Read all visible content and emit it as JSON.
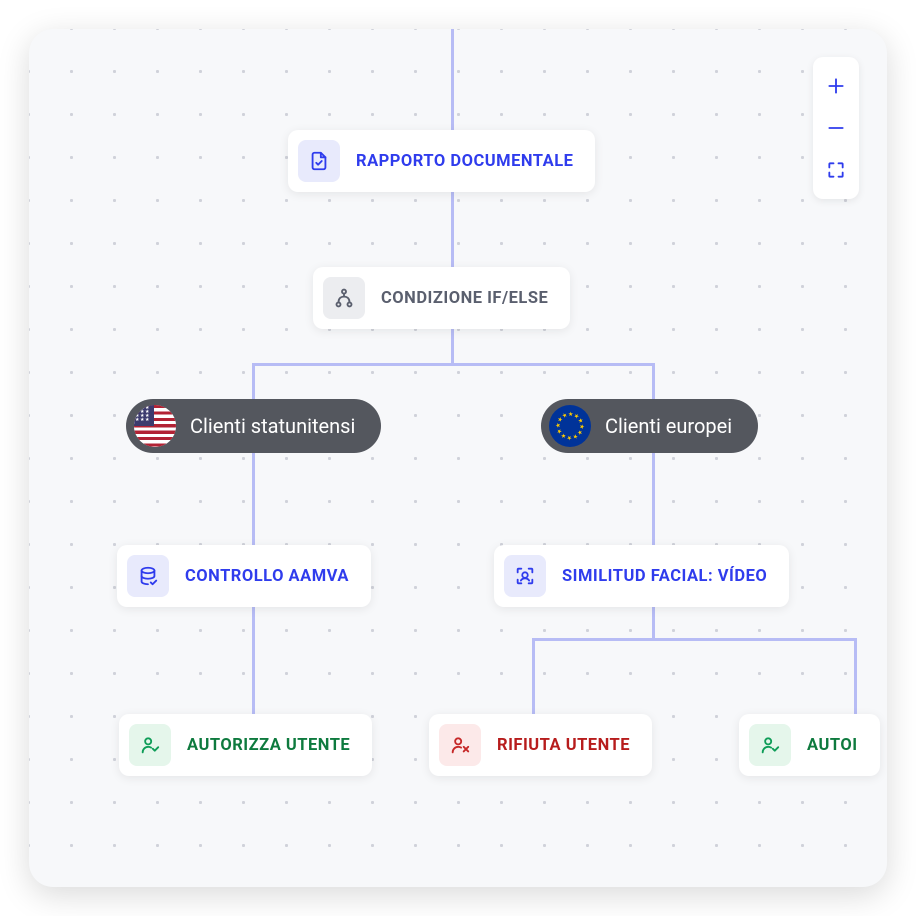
{
  "nodes": {
    "root": {
      "label": "RAPPORTO DOCUMENTALE"
    },
    "condition": {
      "label": "CONDIZIONE IF/ELSE"
    },
    "branch_us": {
      "label": "Clienti statunitensi"
    },
    "branch_eu": {
      "label": "Clienti europei"
    },
    "aamva": {
      "label": "CONTROLLO AAMVA"
    },
    "facial": {
      "label": "SIMILITUD FACIAL: VÍDEO"
    },
    "approve_left": {
      "label": "AUTORIZZA UTENTE"
    },
    "reject": {
      "label": "RIFIUTA UTENTE"
    },
    "approve_right": {
      "label": "AUTOI"
    }
  }
}
